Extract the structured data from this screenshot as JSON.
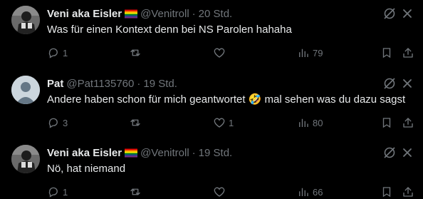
{
  "tweets": [
    {
      "name": "Veni aka Eisler",
      "handle": "@Venitroll",
      "dot": "·",
      "time": "20 Std.",
      "text": "Was für einen Kontext denn bei NS Parolen hahaha",
      "replies": "1",
      "retweets": "",
      "likes": "",
      "views": "79",
      "avatar": "bw-photo"
    },
    {
      "name": "Pat",
      "handle": "@Pat1135760",
      "dot": "·",
      "time": "19 Std.",
      "text_before": "Andere haben schon für mich geantwortet",
      "emoji": "🤣",
      "text_after": "mal sehen was du dazu sagst",
      "replies": "3",
      "retweets": "",
      "likes": "1",
      "views": "80",
      "avatar": "default-profile"
    },
    {
      "name": "Veni aka Eisler",
      "handle": "@Venitroll",
      "dot": "·",
      "time": "19 Std.",
      "text": "Nö, hat niemand",
      "replies": "1",
      "retweets": "",
      "likes": "",
      "views": "66",
      "avatar": "bw-photo"
    }
  ],
  "icons": [
    "reply-icon",
    "retweet-icon",
    "like-icon",
    "views-icon",
    "bookmark-icon",
    "share-icon",
    "grok-icon",
    "more-icon",
    "rainbow-flag-icon"
  ],
  "colors": {
    "background": "#000000",
    "text": "#e7e9ea",
    "muted": "#71767b"
  }
}
